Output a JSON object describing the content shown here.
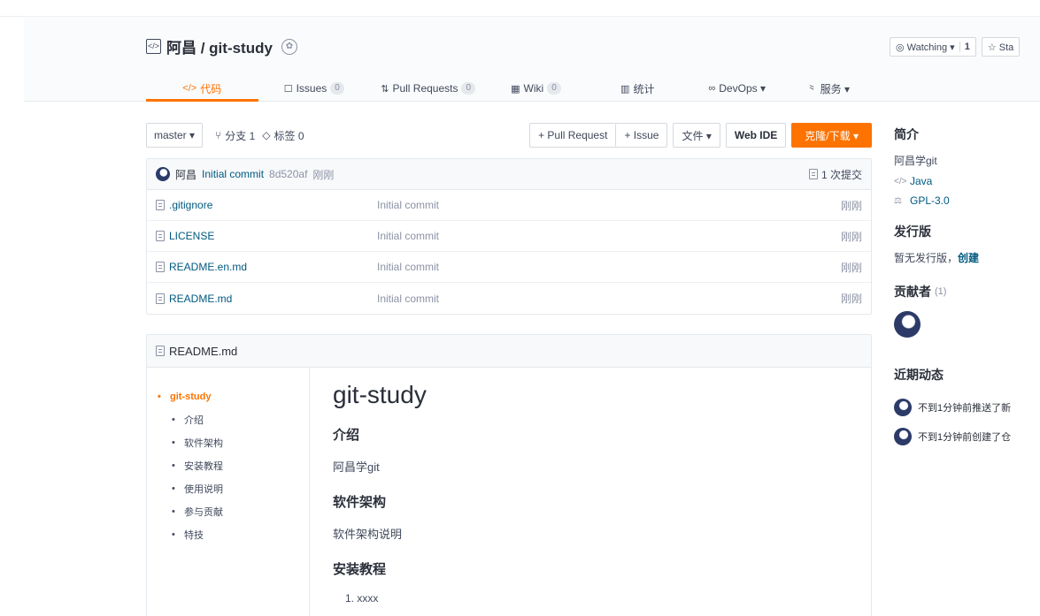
{
  "repo": {
    "title": "阿昌 / git-study",
    "icon": "code-repo-icon",
    "badge_icon": "award-icon"
  },
  "watch": {
    "watch_label": "◎ Watching ▾",
    "watch_count": "1",
    "star_label": "☆ Sta"
  },
  "tabs": [
    {
      "icon": "</>",
      "label": "代码",
      "badge": ""
    },
    {
      "icon": "☐",
      "label": "Issues",
      "badge": "0"
    },
    {
      "icon": "⇅",
      "label": "Pull Requests",
      "badge": "0"
    },
    {
      "icon": "▦",
      "label": "Wiki",
      "badge": "0"
    },
    {
      "icon": "▥",
      "label": "统计",
      "badge": ""
    },
    {
      "icon": "∞",
      "label": "DevOps ▾",
      "badge": ""
    },
    {
      "icon": "⺀",
      "label": "服务 ▾",
      "badge": ""
    }
  ],
  "branch": {
    "selected": "master ▾",
    "branches": "分支 1",
    "tags": "标签 0"
  },
  "actions": {
    "pull_request": "+ Pull Request",
    "issue": "+ Issue",
    "file": "文件 ▾",
    "web_ide": "Web IDE",
    "clone": "克隆/下载 ▾"
  },
  "last_commit": {
    "author": "阿昌",
    "message": "Initial commit",
    "hash": "8d520af",
    "time": "刚刚",
    "count": "1 次提交"
  },
  "files": [
    {
      "name": ".gitignore",
      "commit": "Initial commit",
      "time": "刚刚"
    },
    {
      "name": "LICENSE",
      "commit": "Initial commit",
      "time": "刚刚"
    },
    {
      "name": "README.en.md",
      "commit": "Initial commit",
      "time": "刚刚"
    },
    {
      "name": "README.md",
      "commit": "Initial commit",
      "time": "刚刚"
    }
  ],
  "readme": {
    "filename": "README.md",
    "toc": [
      "git-study",
      "介绍",
      "软件架构",
      "安装教程",
      "使用说明",
      "参与贡献",
      "特技"
    ],
    "h1": "git-study",
    "h2_intro": "介绍",
    "p_intro": "阿昌学git",
    "h2_arch": "软件架构",
    "p_arch": "软件架构说明",
    "h2_install": "安装教程",
    "li_1": "1. xxxx"
  },
  "sidebar": {
    "intro_title": "简介",
    "description": "阿昌学git",
    "language": "Java",
    "license": "GPL-3.0",
    "release_title": "发行版",
    "release_text": "暂无发行版，",
    "release_create": "创建",
    "contributors_title": "贡献者",
    "contributors_count": "(1)",
    "activity_title": "近期动态",
    "activities": [
      "不到1分钟前推送了新",
      "不到1分钟前创建了仓"
    ]
  },
  "colors": {
    "accent": "#fe7300",
    "link": "#005980",
    "text": "#40485b",
    "border": "#e3e9ed"
  }
}
